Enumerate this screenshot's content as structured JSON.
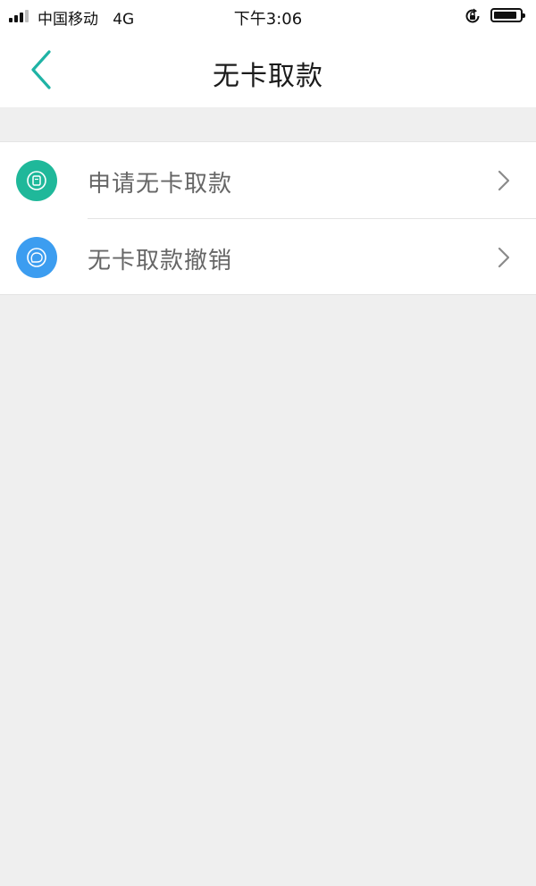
{
  "status_bar": {
    "carrier": "中国移动   4G",
    "time": "下午3:06",
    "battery_level": 0.9,
    "icons": {
      "signal": "signal-strength-icon",
      "orientation_lock": "orientation-lock-icon",
      "battery": "battery-icon"
    }
  },
  "nav": {
    "title": "无卡取款",
    "back_icon": "chevron-left-icon"
  },
  "menu": {
    "items": [
      {
        "label": "申请无卡取款",
        "icon": "apply-card-icon",
        "icon_color": "#1fb89a"
      },
      {
        "label": "无卡取款撤销",
        "icon": "cancel-bubble-icon",
        "icon_color": "#3c9df0"
      }
    ]
  },
  "colors": {
    "accent": "#1fb3a5",
    "background": "#efefef",
    "label_text": "#666666"
  }
}
